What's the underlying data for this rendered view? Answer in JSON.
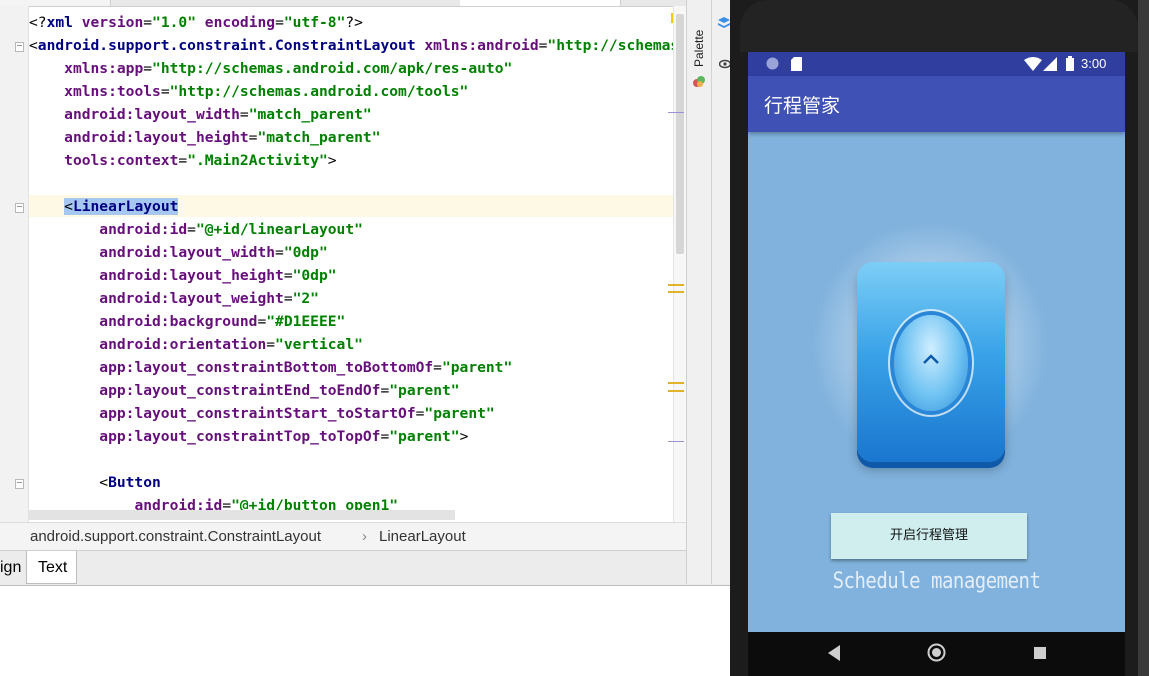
{
  "editor": {
    "lines": [
      {
        "fold": false,
        "parts": [
          {
            "c": "pu",
            "t": "<?"
          },
          {
            "c": "tg",
            "t": "xml "
          },
          {
            "c": "an",
            "t": "version"
          },
          {
            "c": "pu",
            "t": "="
          },
          {
            "c": "av",
            "t": "\"1.0\""
          },
          {
            "c": "pu",
            "t": " "
          },
          {
            "c": "an",
            "t": "encoding"
          },
          {
            "c": "pu",
            "t": "="
          },
          {
            "c": "av",
            "t": "\"utf-8\""
          },
          {
            "c": "pu",
            "t": "?>"
          }
        ]
      },
      {
        "fold": true,
        "parts": [
          {
            "c": "pu",
            "t": "<"
          },
          {
            "c": "tg",
            "t": "android.support.constraint.ConstraintLayout "
          },
          {
            "c": "an",
            "t": "xmlns:android"
          },
          {
            "c": "pu",
            "t": "="
          },
          {
            "c": "av",
            "t": "\"http://schemas.android.com/apk/res/android\""
          }
        ]
      },
      {
        "fold": false,
        "parts": [
          {
            "c": "pu",
            "t": "    "
          },
          {
            "c": "an",
            "t": "xmlns:app"
          },
          {
            "c": "pu",
            "t": "="
          },
          {
            "c": "av",
            "t": "\"http://schemas.android.com/apk/res-auto\""
          }
        ]
      },
      {
        "fold": false,
        "parts": [
          {
            "c": "pu",
            "t": "    "
          },
          {
            "c": "an",
            "t": "xmlns:tools"
          },
          {
            "c": "pu",
            "t": "="
          },
          {
            "c": "av",
            "t": "\"http://schemas.android.com/tools\""
          }
        ]
      },
      {
        "fold": false,
        "parts": [
          {
            "c": "pu",
            "t": "    "
          },
          {
            "c": "an",
            "t": "android:layout_width"
          },
          {
            "c": "pu",
            "t": "="
          },
          {
            "c": "av",
            "t": "\"match_parent\""
          }
        ]
      },
      {
        "fold": false,
        "parts": [
          {
            "c": "pu",
            "t": "    "
          },
          {
            "c": "an",
            "t": "android:layout_height"
          },
          {
            "c": "pu",
            "t": "="
          },
          {
            "c": "av",
            "t": "\"match_parent\""
          }
        ]
      },
      {
        "fold": false,
        "parts": [
          {
            "c": "pu",
            "t": "    "
          },
          {
            "c": "an",
            "t": "tools:context"
          },
          {
            "c": "pu",
            "t": "="
          },
          {
            "c": "av",
            "t": "\".Main2Activity\""
          },
          {
            "c": "pu",
            "t": ">"
          }
        ]
      },
      {
        "fold": false,
        "parts": [
          {
            "c": "pu",
            "t": " "
          }
        ]
      },
      {
        "fold": true,
        "parts": [
          {
            "c": "pu",
            "t": "    "
          },
          {
            "c": "hl",
            "t": "<"
          },
          {
            "c": "tg hl",
            "t": "LinearLayout"
          }
        ]
      },
      {
        "fold": false,
        "parts": [
          {
            "c": "pu",
            "t": "        "
          },
          {
            "c": "an",
            "t": "android:id"
          },
          {
            "c": "pu",
            "t": "="
          },
          {
            "c": "av",
            "t": "\"@+id/linearLayout\""
          }
        ]
      },
      {
        "fold": false,
        "parts": [
          {
            "c": "pu",
            "t": "        "
          },
          {
            "c": "an",
            "t": "android:layout_width"
          },
          {
            "c": "pu",
            "t": "="
          },
          {
            "c": "av",
            "t": "\"0dp\""
          }
        ]
      },
      {
        "fold": false,
        "parts": [
          {
            "c": "pu",
            "t": "        "
          },
          {
            "c": "an",
            "t": "android:layout_height"
          },
          {
            "c": "pu",
            "t": "="
          },
          {
            "c": "av",
            "t": "\"0dp\""
          }
        ]
      },
      {
        "fold": false,
        "parts": [
          {
            "c": "pu",
            "t": "        "
          },
          {
            "c": "an",
            "t": "android:layout_weight"
          },
          {
            "c": "pu",
            "t": "="
          },
          {
            "c": "av",
            "t": "\"2\""
          }
        ]
      },
      {
        "fold": false,
        "parts": [
          {
            "c": "pu",
            "t": "        "
          },
          {
            "c": "an",
            "t": "android:background"
          },
          {
            "c": "pu",
            "t": "="
          },
          {
            "c": "av",
            "t": "\"#D1EEEE\""
          }
        ]
      },
      {
        "fold": false,
        "parts": [
          {
            "c": "pu",
            "t": "        "
          },
          {
            "c": "an",
            "t": "android:orientation"
          },
          {
            "c": "pu",
            "t": "="
          },
          {
            "c": "av",
            "t": "\"vertical\""
          }
        ]
      },
      {
        "fold": false,
        "parts": [
          {
            "c": "pu",
            "t": "        "
          },
          {
            "c": "an",
            "t": "app:layout_constraintBottom_toBottomOf"
          },
          {
            "c": "pu",
            "t": "="
          },
          {
            "c": "av",
            "t": "\"parent\""
          }
        ]
      },
      {
        "fold": false,
        "parts": [
          {
            "c": "pu",
            "t": "        "
          },
          {
            "c": "an",
            "t": "app:layout_constraintEnd_toEndOf"
          },
          {
            "c": "pu",
            "t": "="
          },
          {
            "c": "av",
            "t": "\"parent\""
          }
        ]
      },
      {
        "fold": false,
        "parts": [
          {
            "c": "pu",
            "t": "        "
          },
          {
            "c": "an",
            "t": "app:layout_constraintStart_toStartOf"
          },
          {
            "c": "pu",
            "t": "="
          },
          {
            "c": "av",
            "t": "\"parent\""
          }
        ]
      },
      {
        "fold": false,
        "parts": [
          {
            "c": "pu",
            "t": "        "
          },
          {
            "c": "an",
            "t": "app:layout_constraintTop_toTopOf"
          },
          {
            "c": "pu",
            "t": "="
          },
          {
            "c": "av",
            "t": "\"parent\""
          },
          {
            "c": "pu",
            "t": ">"
          }
        ]
      },
      {
        "fold": false,
        "parts": [
          {
            "c": "pu",
            "t": " "
          }
        ]
      },
      {
        "fold": true,
        "parts": [
          {
            "c": "pu",
            "t": "        <"
          },
          {
            "c": "tg",
            "t": "Button"
          }
        ]
      },
      {
        "fold": false,
        "parts": [
          {
            "c": "pu",
            "t": "            "
          },
          {
            "c": "an",
            "t": "android:id"
          },
          {
            "c": "pu",
            "t": "="
          },
          {
            "c": "av",
            "t": "\"@+id/button_open1\""
          }
        ]
      }
    ]
  },
  "breadcrumb": {
    "item1": "android.support.constraint.ConstraintLayout",
    "separator": "›",
    "item2": "LinearLayout"
  },
  "bottom_tabs": {
    "design": "ign",
    "text": "Text"
  },
  "side_panel": {
    "palette": "Palette"
  },
  "phone": {
    "status_time": "3:00",
    "app_title": "行程管家",
    "open_button": "开启行程管理",
    "caption": "Schedule management",
    "colors": {
      "status_bar": "#303f9f",
      "app_bar": "#3f51b5",
      "screen_bg": "#80b2dd",
      "button_bg": "#d1eeee"
    }
  }
}
